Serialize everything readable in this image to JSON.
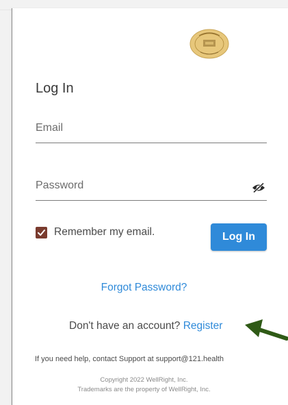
{
  "login": {
    "title": "Log In",
    "email_placeholder": "Email",
    "password_placeholder": "Password",
    "remember_label": "Remember my email.",
    "remember_checked": true,
    "button_label": "Log In",
    "forgot_link": "Forgot Password?",
    "no_account_text": "Don't have an account?",
    "register_link": "Register",
    "help_text": "If you need help, contact Support at support@121.health",
    "copyright_line1": "Copyright 2022 WellRight, Inc.",
    "copyright_line2": "Trademarks are the property of WellRight, Inc."
  },
  "icons": {
    "logo": "county-seal-icon",
    "password_toggle": "eye-slash-icon",
    "remember_check": "checkmark-icon",
    "annotation": "green-arrow-icon"
  },
  "colors": {
    "accent": "#2f8ad9",
    "checkbox": "#7a3b2e",
    "arrow": "#2f5a16",
    "seal": "#e7c77b"
  }
}
